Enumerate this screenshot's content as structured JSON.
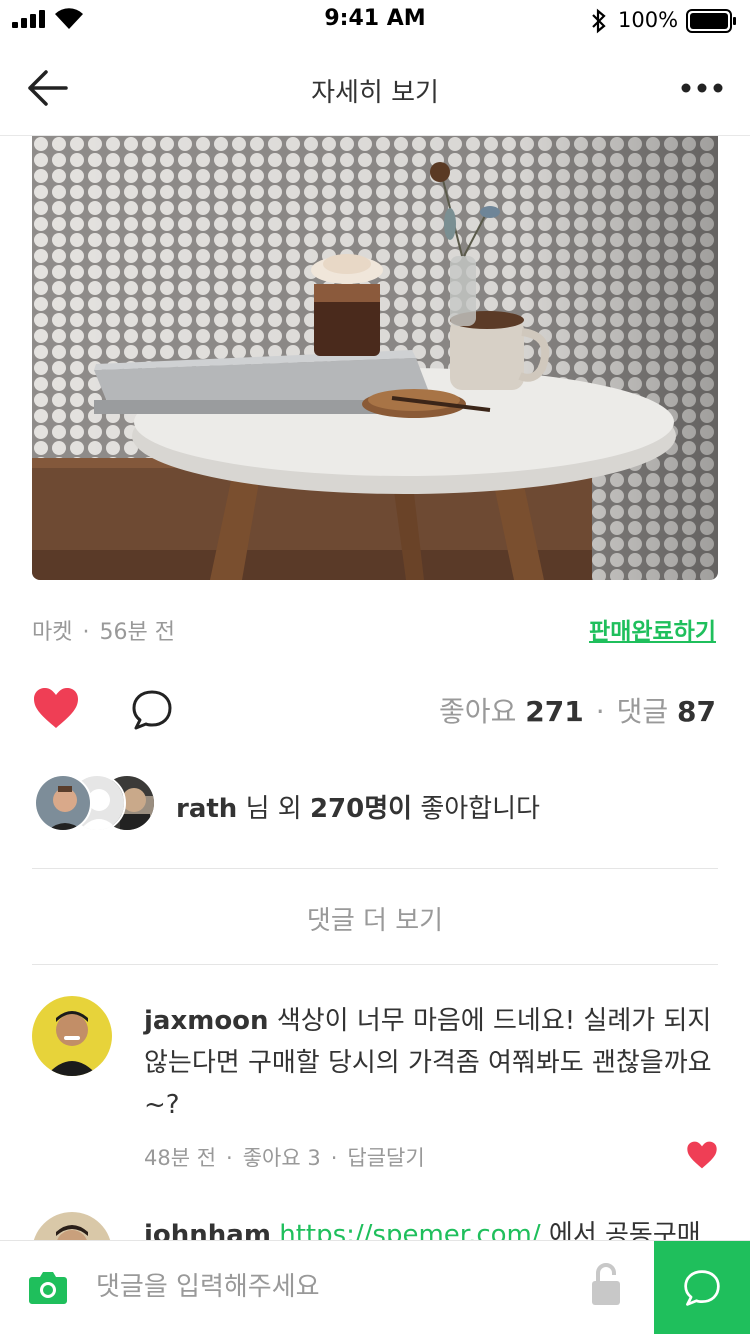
{
  "status_bar": {
    "time": "9:41 AM",
    "battery": "100%"
  },
  "nav": {
    "title": "자세히 보기"
  },
  "post": {
    "category": "마켓",
    "time_ago": "56분 전",
    "sold_action": "판매완료하기",
    "likes_label": "좋아요",
    "likes_count": "271",
    "comments_label": "댓글",
    "comments_count": "87"
  },
  "likers": {
    "name": "rath",
    "middle": " 님 외 ",
    "others": "270명이",
    "suffix": " 좋아합니다"
  },
  "more_comments": "댓글 더 보기",
  "comments": [
    {
      "user": "jaxmoon",
      "text": " 색상이 너무 마음에 드네요! 실례가 되지 않는다면 구매할 당시의 가격좀 여쭤봐도 괜찮을까요~?",
      "time_ago": "48분 전",
      "likes": "좋아요 3",
      "reply": "답글달기"
    },
    {
      "user": "johnham",
      "link": "https://spemer.com/",
      "text": " 에서 공동구매"
    }
  ],
  "composer": {
    "placeholder": "댓글을 입력해주세요"
  },
  "colors": {
    "accent": "#1fbf5c",
    "heart": "#ef3e55"
  }
}
